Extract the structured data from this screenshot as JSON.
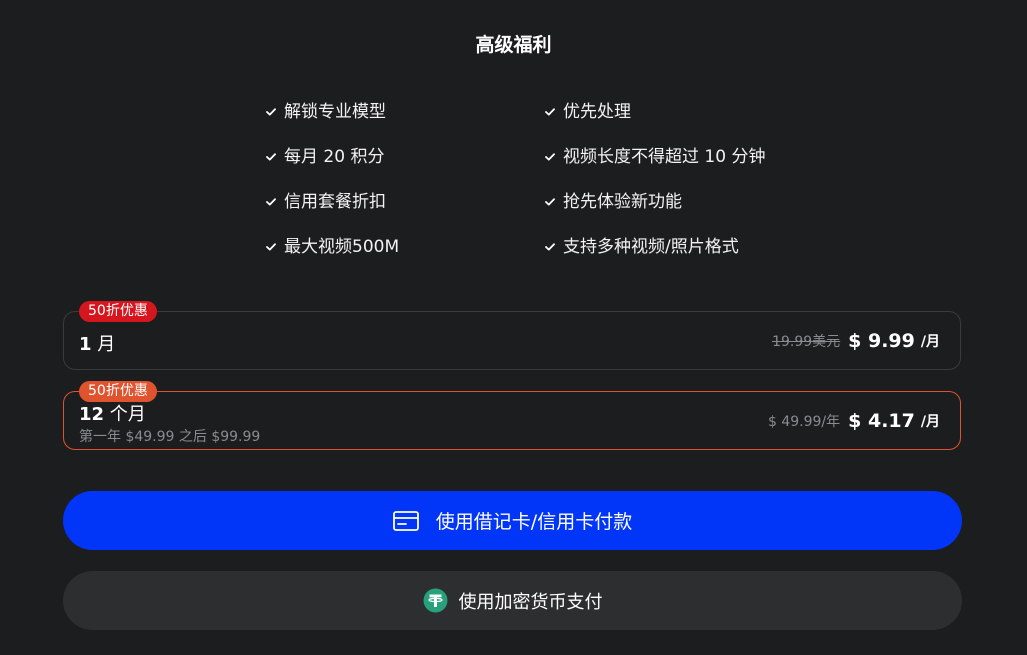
{
  "header": {
    "title": "高级福利"
  },
  "features": [
    {
      "label": "解锁专业模型",
      "icon": "check-icon"
    },
    {
      "label": "优先处理",
      "icon": "check-icon"
    },
    {
      "label": "每月 20 积分",
      "icon": "check-icon"
    },
    {
      "label": "视频长度不得超过 10 分钟",
      "icon": "check-icon"
    },
    {
      "label": "信用套餐折扣",
      "icon": "check-icon"
    },
    {
      "label": "抢先体验新功能",
      "icon": "check-icon"
    },
    {
      "label": "最大视频500M",
      "icon": "check-icon"
    },
    {
      "label": "支持多种视频/照片格式",
      "icon": "check-icon"
    }
  ],
  "plans": [
    {
      "badge": "50折优惠",
      "badge_color": "#d6161e",
      "name_number": "1",
      "name_unit": " 月",
      "subtitle": "",
      "original_price": "19.99美元",
      "price": "$ 9.99",
      "period": "/月",
      "selected": false
    },
    {
      "badge": "50折优惠",
      "badge_color": "#e0532f",
      "name_number": "12",
      "name_unit": " 个月",
      "subtitle": "第一年 $49.99 之后 $99.99",
      "original_price": "$ 49.99/年",
      "price": "$ 4.17",
      "period": "/月",
      "selected": true
    }
  ],
  "actions": {
    "card_pay_label": "使用借记卡/信用卡付款",
    "card_pay_icon": "credit-card-icon",
    "crypto_pay_label": "使用加密货币支付",
    "crypto_pay_icon": "tether-icon"
  },
  "colors": {
    "background": "#1c1d1f",
    "primary_button": "#0136f9",
    "secondary_button": "#2d2e30",
    "selected_border": "#e0532f",
    "tether_green": "#26a17b"
  }
}
